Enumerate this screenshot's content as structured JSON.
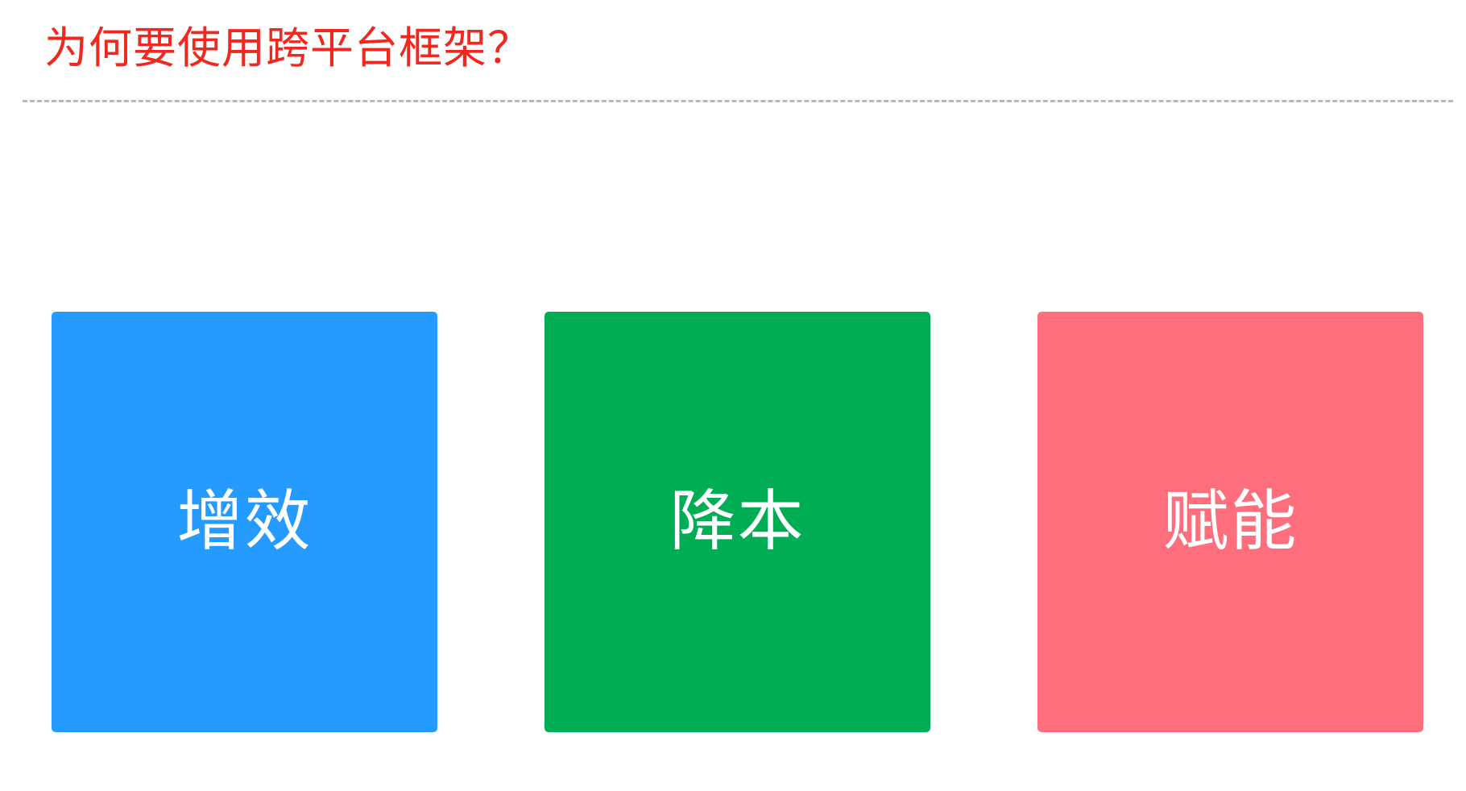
{
  "header": {
    "title": "为何要使用跨平台框架？",
    "title_color": "#f0281e"
  },
  "cards": [
    {
      "label": "增效",
      "color": "#269bff"
    },
    {
      "label": "降本",
      "color": "#00ad55"
    },
    {
      "label": "赋能",
      "color": "#ff6e7d"
    }
  ]
}
